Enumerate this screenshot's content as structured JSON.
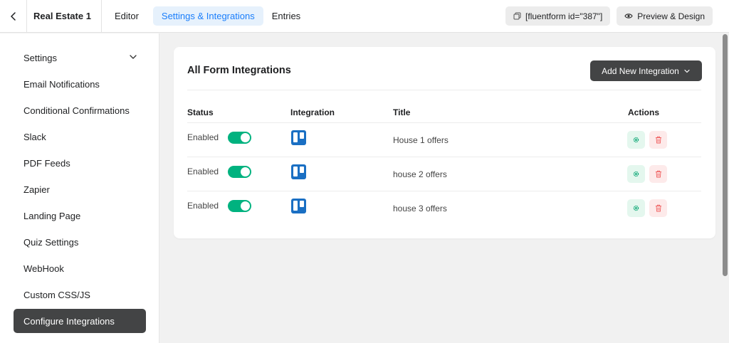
{
  "topbar": {
    "form_name": "Real Estate 1",
    "tabs": [
      {
        "label": "Editor"
      },
      {
        "label": "Settings & Integrations"
      },
      {
        "label": "Entries"
      }
    ],
    "shortcode_label": "[fluentform id=\"387\"]",
    "preview_label": "Preview & Design"
  },
  "sidebar": {
    "items": [
      {
        "label": "Settings"
      },
      {
        "label": "Email Notifications"
      },
      {
        "label": "Conditional Confirmations"
      },
      {
        "label": "Slack"
      },
      {
        "label": "PDF Feeds"
      },
      {
        "label": "Zapier"
      },
      {
        "label": "Landing Page"
      },
      {
        "label": "Quiz Settings"
      },
      {
        "label": "WebHook"
      },
      {
        "label": "Custom CSS/JS"
      },
      {
        "label": "Configure Integrations"
      }
    ]
  },
  "main": {
    "title": "All Form Integrations",
    "add_button_label": "Add New Integration",
    "columns": {
      "status": "Status",
      "integration": "Integration",
      "title": "Title",
      "actions": "Actions"
    },
    "rows": [
      {
        "status": "Enabled",
        "integration_icon": "trello-icon",
        "title": "House 1 offers"
      },
      {
        "status": "Enabled",
        "integration_icon": "trello-icon",
        "title": "house 2 offers"
      },
      {
        "status": "Enabled",
        "integration_icon": "trello-icon",
        "title": "house 3 offers"
      }
    ]
  },
  "colors": {
    "accent": "#1a7efb",
    "toggle_on": "#00b27f",
    "dark_button": "#434445",
    "trello": "#1a6fc3"
  }
}
